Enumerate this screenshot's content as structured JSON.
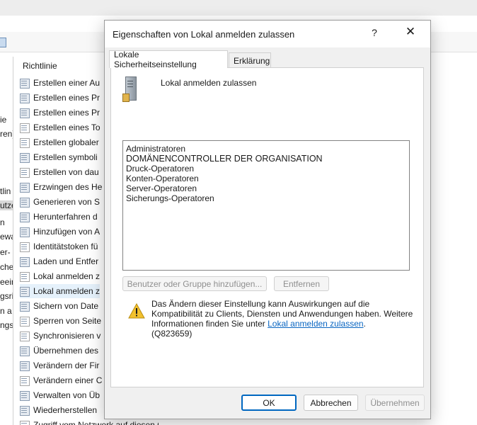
{
  "background": {
    "left_pane_fragments": [
      "ie",
      "ren)",
      "tlin",
      "utze",
      "n",
      "ewa",
      "er-",
      "che",
      "eeir",
      "gsri",
      "n a",
      "ngs"
    ],
    "policy_list": {
      "header": "Richtlinie",
      "rows": [
        {
          "label": "Erstellen einer Au",
          "icon": "policy-icon"
        },
        {
          "label": "Erstellen eines Pr",
          "icon": "policy-icon"
        },
        {
          "label": "Erstellen eines Pr",
          "icon": "policy-icon"
        },
        {
          "label": "Erstellen eines To",
          "icon": "policy-icon-alt"
        },
        {
          "label": "Erstellen globaler",
          "icon": "policy-icon-alt"
        },
        {
          "label": "Erstellen symboli",
          "icon": "policy-icon"
        },
        {
          "label": "Erstellen von dau",
          "icon": "policy-icon-alt"
        },
        {
          "label": "Erzwingen des He",
          "icon": "policy-icon"
        },
        {
          "label": "Generieren von S",
          "icon": "policy-icon"
        },
        {
          "label": "Herunterfahren d",
          "icon": "policy-icon"
        },
        {
          "label": "Hinzufügen von A",
          "icon": "policy-icon"
        },
        {
          "label": "Identitätstoken fü",
          "icon": "policy-icon-alt"
        },
        {
          "label": "Laden und Entfer",
          "icon": "policy-icon"
        },
        {
          "label": "Lokal anmelden z",
          "icon": "policy-icon-alt"
        },
        {
          "label": "Lokal anmelden z",
          "icon": "policy-icon",
          "selected": true
        },
        {
          "label": "Sichern von Date",
          "icon": "policy-icon"
        },
        {
          "label": "Sperren von Seite",
          "icon": "policy-icon-alt"
        },
        {
          "label": "Synchronisieren v",
          "icon": "policy-icon-alt"
        },
        {
          "label": "Übernehmen des",
          "icon": "policy-icon"
        },
        {
          "label": "Verändern der Fir",
          "icon": "policy-icon"
        },
        {
          "label": "Verändern einer C",
          "icon": "policy-icon-alt"
        },
        {
          "label": "Verwalten von Üb",
          "icon": "policy-icon"
        },
        {
          "label": "Wiederherstellen",
          "icon": "policy-icon"
        },
        {
          "label": "Zugriff vom Netzwerk auf diesen Computer verweigern",
          "icon": "policy-icon-alt"
        }
      ]
    }
  },
  "dialog": {
    "title": "Eigenschaften von Lokal anmelden zulassen",
    "help_label": "?",
    "close_label": "✕",
    "tabs": [
      "Lokale Sicherheitseinstellung",
      "Erklärung"
    ],
    "policy_name": "Lokal anmelden zulassen",
    "members": [
      "Administratoren",
      "DOMÄNENCONTROLLER DER ORGANISATION",
      "Druck-Operatoren",
      "Konten-Operatoren",
      "Server-Operatoren",
      "Sicherungs-Operatoren"
    ],
    "add_button": "Benutzer oder Gruppe hinzufügen...",
    "remove_button": "Entfernen",
    "warning_text": "Das Ändern dieser Einstellung kann Auswirkungen auf die Kompatibilität zu Clients, Diensten und Anwendungen haben. Weitere Informationen finden Sie unter",
    "warning_link": "Lokal anmelden zulassen",
    "warning_suffix": ".",
    "warning_kb": "(Q823659)",
    "ok_button": "OK",
    "cancel_button": "Abbrechen",
    "apply_button": "Übernehmen"
  },
  "colors": {
    "accent": "#0067c0",
    "link": "#0a66c2",
    "selection": "#e5f1fb",
    "warning": "#f2c12e"
  }
}
